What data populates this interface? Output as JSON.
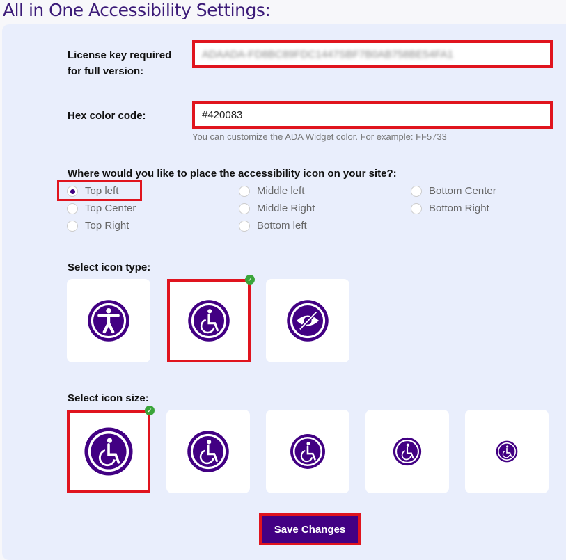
{
  "title": "All in One Accessibility Settings:",
  "license": {
    "label_line1": "License key required",
    "label_line2": "for full version:",
    "value": "ADAADA-FD8BC89FDC1447SBF7B0AB758BE54FA1"
  },
  "hex": {
    "label": "Hex color code:",
    "value": "#420083",
    "help": "You can customize the ADA Widget color. For example: FF5733"
  },
  "placement": {
    "question": "Where would you like to place the accessibility icon on your site?:",
    "options": [
      "Top left",
      "Top Center",
      "Top Right",
      "Middle left",
      "Middle Right",
      "Bottom left",
      "Bottom Center",
      "Bottom Right"
    ],
    "selected": "Top left"
  },
  "icon_type": {
    "label": "Select icon type:",
    "options": [
      "accessibility-person-icon",
      "wheelchair-icon",
      "eye-slash-icon"
    ],
    "selected": "wheelchair-icon"
  },
  "icon_size": {
    "label": "Select icon size:",
    "selected_index": 0
  },
  "save_label": "Save Changes",
  "colors": {
    "accent": "#420083",
    "highlight": "#e0141e",
    "check": "#3aa53a"
  }
}
